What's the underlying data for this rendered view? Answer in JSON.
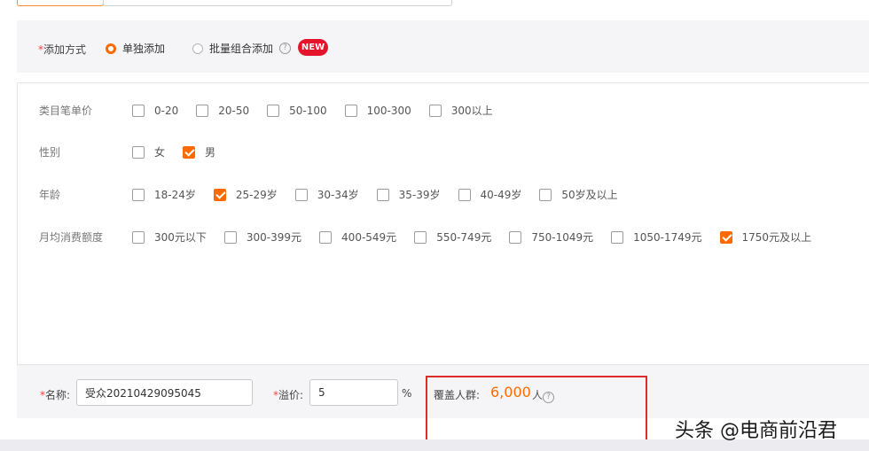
{
  "mode": {
    "required_mark": "*",
    "label": "添加方式",
    "options": [
      {
        "label": "单独添加",
        "selected": true
      },
      {
        "label": "批量组合添加",
        "selected": false
      }
    ],
    "help_glyph": "?",
    "new_badge": "NEW"
  },
  "filters": [
    {
      "label": "类目笔单价",
      "options": [
        {
          "label": "0-20",
          "checked": false
        },
        {
          "label": "20-50",
          "checked": false
        },
        {
          "label": "50-100",
          "checked": false
        },
        {
          "label": "100-300",
          "checked": false
        },
        {
          "label": "300以上",
          "checked": false
        }
      ]
    },
    {
      "label": "性别",
      "options": [
        {
          "label": "女",
          "checked": false
        },
        {
          "label": "男",
          "checked": true
        }
      ]
    },
    {
      "label": "年龄",
      "options": [
        {
          "label": "18-24岁",
          "checked": false
        },
        {
          "label": "25-29岁",
          "checked": true
        },
        {
          "label": "30-34岁",
          "checked": false
        },
        {
          "label": "35-39岁",
          "checked": false
        },
        {
          "label": "40-49岁",
          "checked": false
        },
        {
          "label": "50岁及以上",
          "checked": false
        }
      ]
    },
    {
      "label": "月均消费额度",
      "options": [
        {
          "label": "300元以下",
          "checked": false
        },
        {
          "label": "300-399元",
          "checked": false
        },
        {
          "label": "400-549元",
          "checked": false
        },
        {
          "label": "550-749元",
          "checked": false
        },
        {
          "label": "750-1049元",
          "checked": false
        },
        {
          "label": "1050-1749元",
          "checked": false
        },
        {
          "label": "1750元及以上",
          "checked": true
        }
      ]
    }
  ],
  "bottom": {
    "required_mark": "*",
    "name_label": "名称:",
    "name_value": "受众20210429095045",
    "premium_label": "溢价:",
    "premium_value": "5",
    "premium_unit": "%",
    "coverage_label": "覆盖人群:",
    "coverage_value": "6,000",
    "coverage_unit": "人",
    "help_glyph": "?"
  },
  "watermark": "头条 @电商前沿君",
  "colors": {
    "accent": "#ff6a00",
    "required": "#ff3d3d",
    "badge": "#e4152a",
    "highlight": "#e02b2b"
  }
}
